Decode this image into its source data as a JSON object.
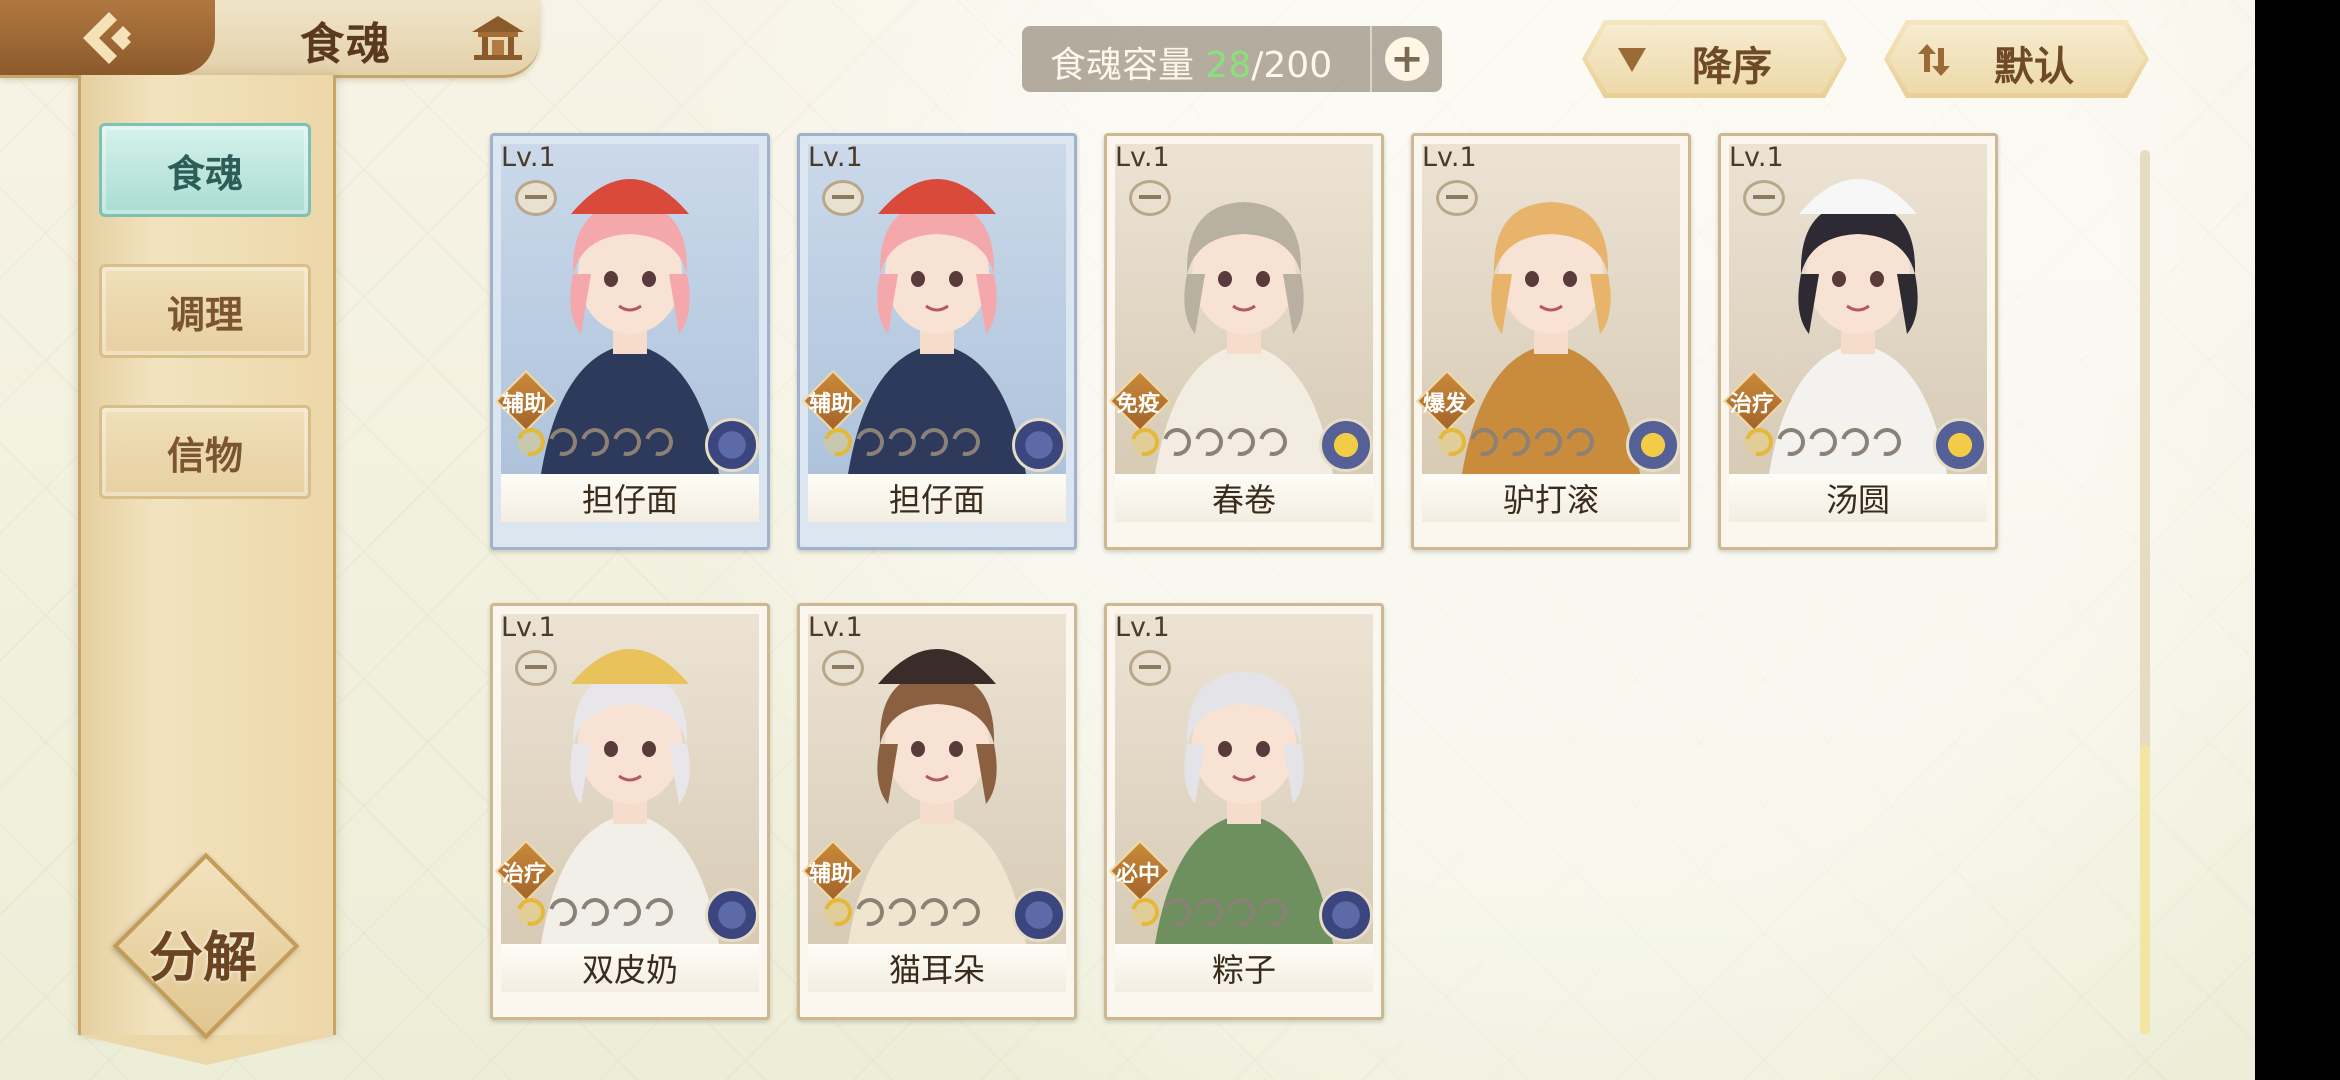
{
  "header": {
    "title": "食魂"
  },
  "capacity": {
    "label": "食魂容量 ",
    "current": "28",
    "separator": "/",
    "max": "200"
  },
  "sort": {
    "order_label": "降序",
    "default_label": "默认"
  },
  "sidebar": {
    "tabs": [
      {
        "label": "食魂",
        "active": true
      },
      {
        "label": "调理",
        "active": false
      },
      {
        "label": "信物",
        "active": false
      }
    ],
    "decompose_label": "分解"
  },
  "cards": [
    {
      "level": "Lv.1",
      "role": "辅助",
      "name": "担仔面",
      "frame": "blue",
      "stars_lit": 1,
      "element": "blue-icon"
    },
    {
      "level": "Lv.1",
      "role": "辅助",
      "name": "担仔面",
      "frame": "blue",
      "stars_lit": 1,
      "element": "blue-icon"
    },
    {
      "level": "Lv.1",
      "role": "免疫",
      "name": "春卷",
      "frame": "white",
      "stars_lit": 1,
      "element": "gold-icon"
    },
    {
      "level": "Lv.1",
      "role": "爆发",
      "name": "驴打滚",
      "frame": "white",
      "stars_lit": 1,
      "element": "gold-icon"
    },
    {
      "level": "Lv.1",
      "role": "治疗",
      "name": "汤圆",
      "frame": "white",
      "stars_lit": 1,
      "element": "gold-icon"
    },
    {
      "level": "Lv.1",
      "role": "治疗",
      "name": "双皮奶",
      "frame": "white",
      "stars_lit": 1,
      "element": "blue-icon"
    },
    {
      "level": "Lv.1",
      "role": "辅助",
      "name": "猫耳朵",
      "frame": "white",
      "stars_lit": 1,
      "element": "blue-icon"
    },
    {
      "level": "Lv.1",
      "role": "必中",
      "name": "粽子",
      "frame": "white",
      "stars_lit": 1,
      "element": "blue-icon"
    }
  ],
  "colors": {
    "accent_active_tab": "#a9dcd2",
    "capacity_current": "#8be07a",
    "brand_brown": "#6e4a26"
  }
}
